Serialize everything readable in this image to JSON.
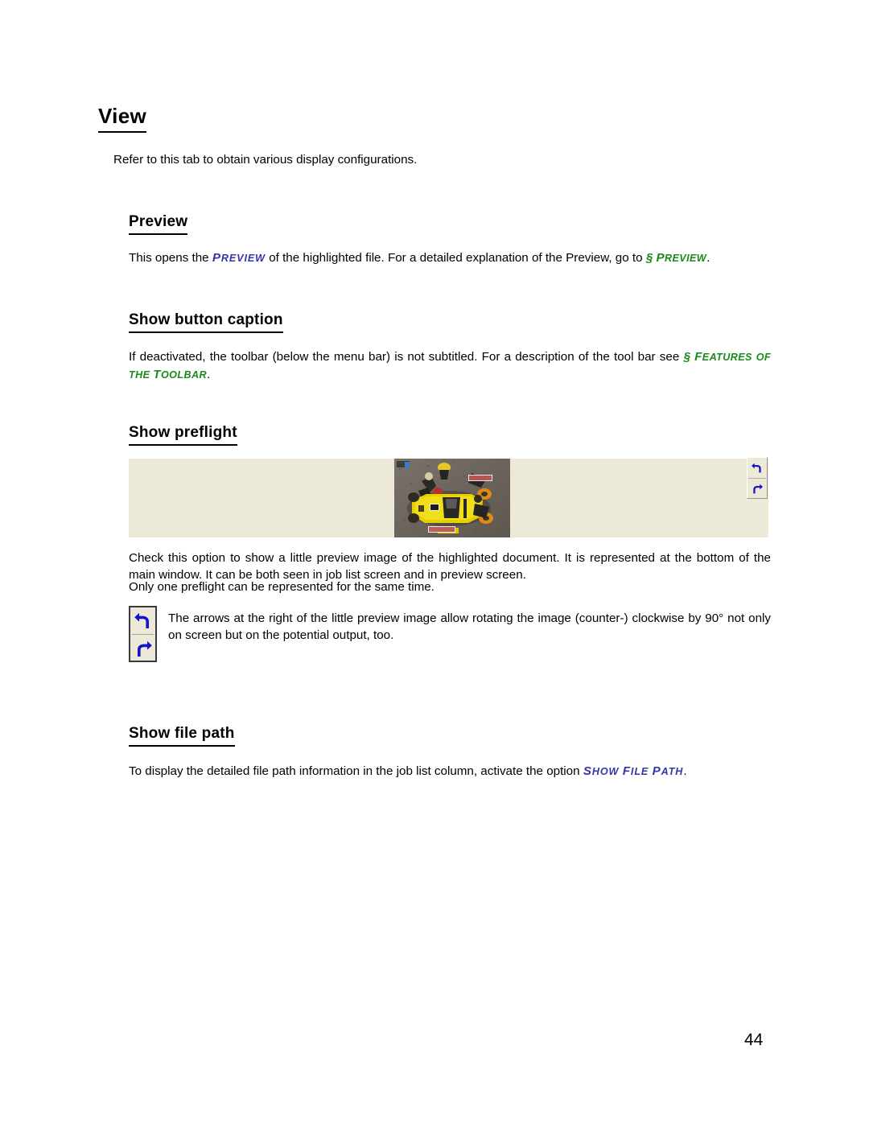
{
  "document": {
    "page_number": "44",
    "heading": "View",
    "intro": "Refer to this tab to obtain various display configurations."
  },
  "colors": {
    "reference_blue": "#3535A6",
    "reference_green": "#1A8A1A",
    "preflight_background": "#ECE9D8",
    "arrow_blue": "#1414C8",
    "text_black": "#000000"
  },
  "sections": [
    {
      "id": "preview",
      "heading": "Preview",
      "body_before": "This opens the ",
      "ref_inline": "Preview",
      "body_middle": " of the highlighted file. For a detailed explanation of the Preview, go to ",
      "ref_section_marker": "§ ",
      "ref_section": "Preview",
      "body_after": "."
    },
    {
      "id": "show-button-caption",
      "heading": "Show button caption",
      "body_before": "If deactivated, the toolbar (below the menu bar) is not subtitled. For a description of the tool bar see ",
      "ref_section_marker": "§ ",
      "ref_section_line1": "Features",
      "ref_section_line2": "of the Toolbar",
      "body_after": "."
    },
    {
      "id": "show-preflight",
      "heading": "Show preflight",
      "body_line1": "Check this option to show a little preview image of the highlighted document. It is represented at the bottom of the main window. It can be both seen in job list screen and in preview screen.",
      "body_line2": "Only one preflight can be represented for the same time.",
      "note": "The arrows at the right of the little preview image allow rotating the image (counter-) clockwise by 90° not only on screen but on the potential output, too."
    },
    {
      "id": "show-file-path",
      "heading": "Show file path",
      "body_before": "To display the detailed file path information in the job list column, activate the option ",
      "ref_inline": "Show File Path",
      "body_after": "."
    }
  ],
  "preflight_widget": {
    "thumbnail_alt": "Yellow race car with pit crew viewed from above on asphalt",
    "rotate_ccw_label": "Rotate counter-clockwise",
    "rotate_cw_label": "Rotate clockwise"
  }
}
